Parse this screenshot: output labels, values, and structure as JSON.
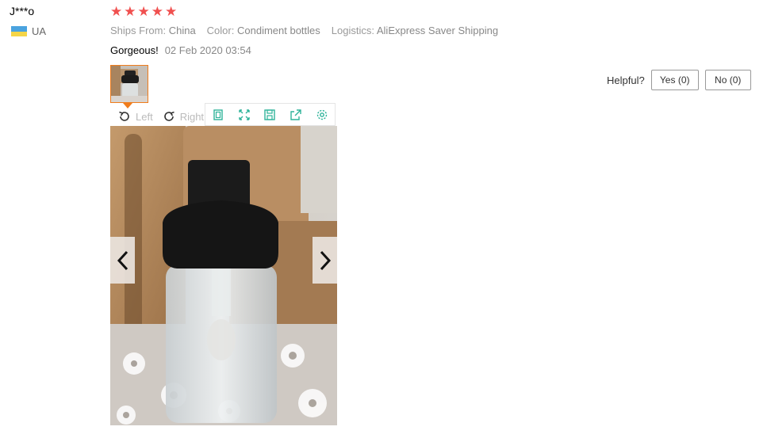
{
  "review": {
    "user_name": "J***o",
    "country": "UA",
    "stars": 5,
    "ships_from_label": "Ships From:",
    "ships_from_value": "China",
    "color_label": "Color:",
    "color_value": "Condiment bottles",
    "logistics_label": "Logistics:",
    "logistics_value": "AliExpress Saver Shipping",
    "feedback": "Gorgeous!",
    "date": "02 Feb 2020 03:54"
  },
  "helpful": {
    "label": "Helpful?",
    "yes": "Yes (0)",
    "no": "No (0)"
  },
  "viewer": {
    "rotate_left": "Left",
    "rotate_right": "Right",
    "tools": [
      "fit-icon",
      "fullscreen-icon",
      "save-icon",
      "share-icon",
      "settings-icon"
    ]
  },
  "colors": {
    "star": "#f0504f",
    "accent": "#f07c1b",
    "tool_icon": "#2fb39a"
  }
}
